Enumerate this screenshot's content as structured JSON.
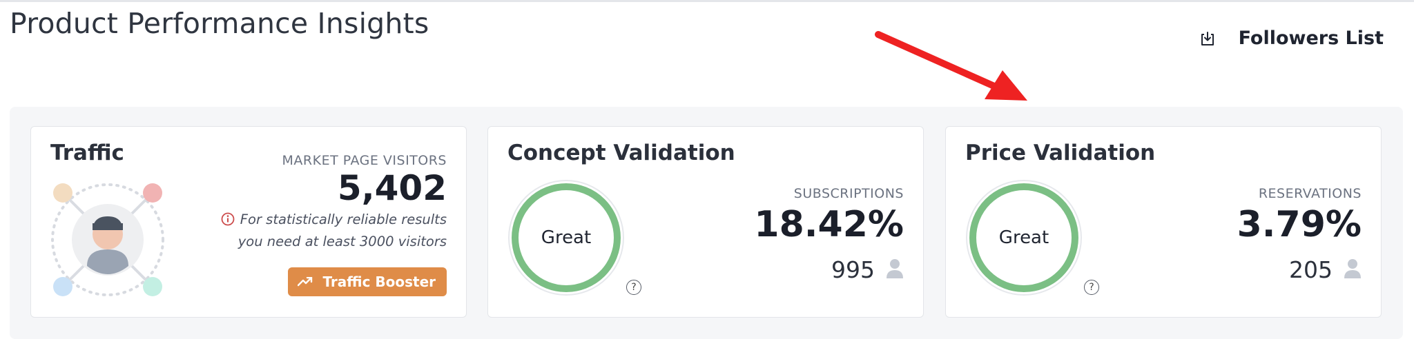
{
  "page": {
    "title": "Product Performance Insights",
    "followers_label": "Followers List"
  },
  "traffic": {
    "title": "Traffic",
    "metric_label": "MARKET PAGE VISITORS",
    "metric_value": "5,402",
    "warning_line1": "For statistically reliable results",
    "warning_line2": "you need at least 3000 visitors",
    "button_label": "Traffic Booster"
  },
  "concept": {
    "title": "Concept Validation",
    "rating": "Great",
    "help": "?",
    "metric_label": "SUBSCRIPTIONS",
    "metric_value": "18.42%",
    "count": "995"
  },
  "price": {
    "title": "Price Validation",
    "rating": "Great",
    "help": "?",
    "metric_label": "RESERVATIONS",
    "metric_value": "3.79%",
    "count": "205"
  },
  "colors": {
    "accent_orange": "#df8c48",
    "ring_green": "#7bbf84",
    "arrow_red": "#ee2222",
    "warning_red": "#cc4b4b"
  },
  "icons": [
    "download-icon",
    "arrow-annotation-icon",
    "info-icon",
    "trend-up-icon",
    "user-icon",
    "avatar-network-illustration"
  ]
}
